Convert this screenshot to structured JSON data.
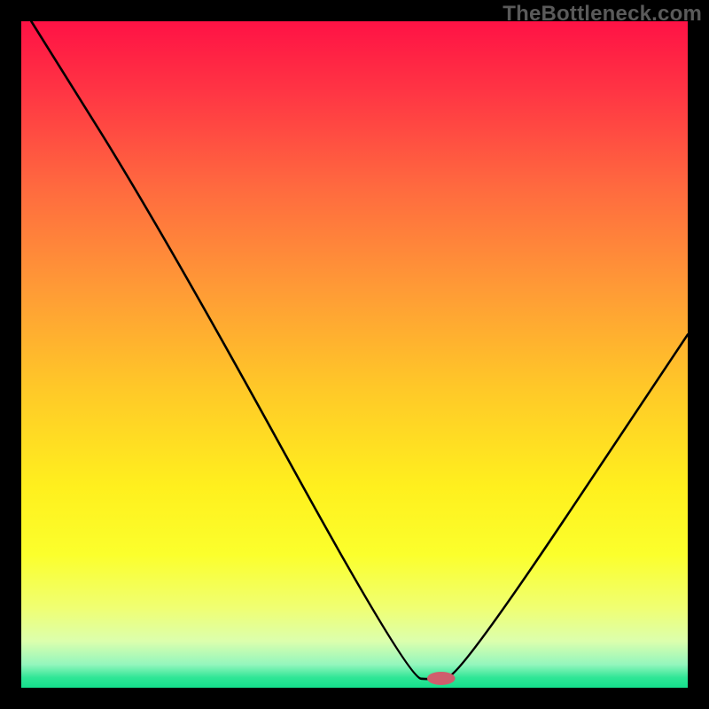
{
  "watermark": "TheBottleneck.com",
  "chart_data": {
    "type": "line",
    "title": "",
    "xlabel": "",
    "ylabel": "",
    "xlim": [
      0,
      100
    ],
    "ylim": [
      0,
      100
    ],
    "curve": {
      "name": "bottleneck-curve",
      "points": [
        {
          "x": 1.5,
          "y": 100
        },
        {
          "x": 21.5,
          "y": 68
        },
        {
          "x": 58,
          "y": 1.5
        },
        {
          "x": 62,
          "y": 1.2
        },
        {
          "x": 66,
          "y": 2.0
        },
        {
          "x": 100,
          "y": 53
        }
      ]
    },
    "marker": {
      "x": 63,
      "y": 1.4,
      "rx": 2.1,
      "ry": 1.0,
      "color": "#cf5e6d"
    },
    "gradient_stops": [
      {
        "offset": 0.0,
        "color": "#ff1245"
      },
      {
        "offset": 0.1,
        "color": "#ff3344"
      },
      {
        "offset": 0.25,
        "color": "#ff6a3f"
      },
      {
        "offset": 0.4,
        "color": "#ff9a36"
      },
      {
        "offset": 0.55,
        "color": "#ffc828"
      },
      {
        "offset": 0.7,
        "color": "#fff01e"
      },
      {
        "offset": 0.8,
        "color": "#fbff2c"
      },
      {
        "offset": 0.88,
        "color": "#f0ff72"
      },
      {
        "offset": 0.93,
        "color": "#dcffad"
      },
      {
        "offset": 0.965,
        "color": "#94f6bd"
      },
      {
        "offset": 0.985,
        "color": "#2fe696"
      },
      {
        "offset": 1.0,
        "color": "#14df8c"
      }
    ]
  }
}
